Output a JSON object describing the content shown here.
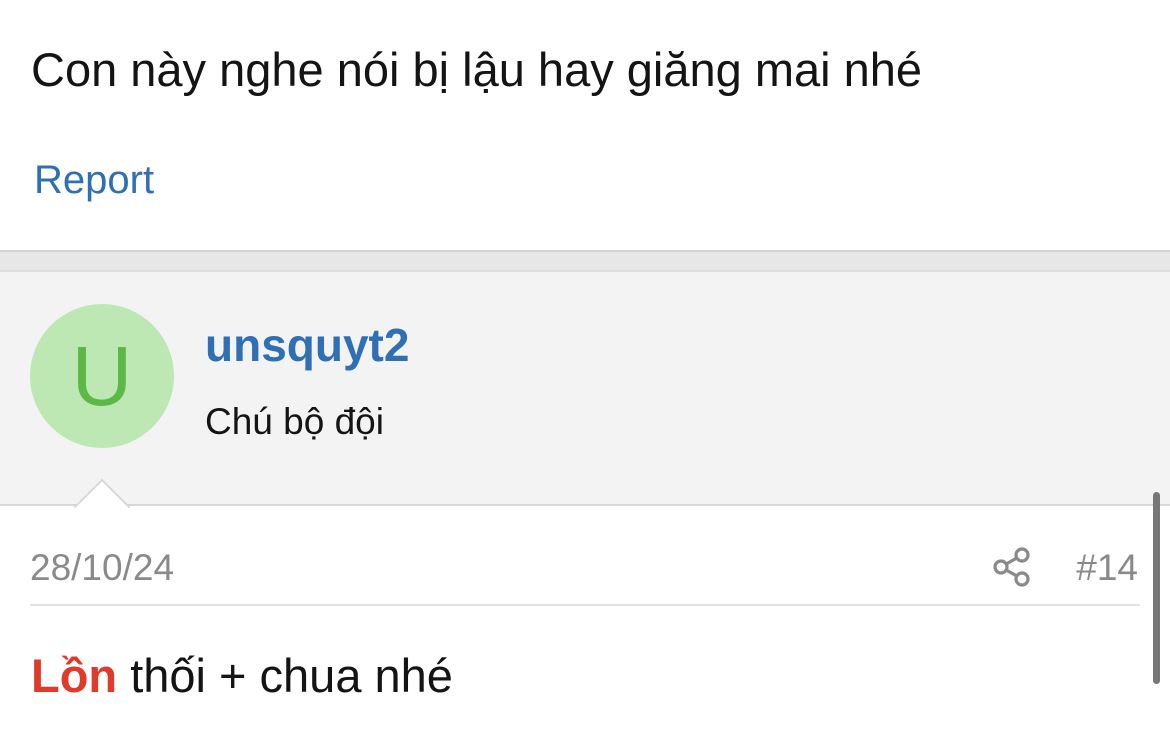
{
  "previous_post": {
    "text": "Con này nghe nói bị lậu hay giăng mai nhé",
    "report_label": "Report"
  },
  "user": {
    "avatar_letter": "U",
    "avatar_bg": "#bde8b3",
    "avatar_fg": "#5db848",
    "username": "unsquyt2",
    "title": "Chú bộ đội"
  },
  "post": {
    "date": "28/10/24",
    "number": "#14",
    "share_icon": "share-icon",
    "highlight_word": "Lồn",
    "highlight_color": "#e03a2a",
    "body_rest": " thối + chua nhé"
  },
  "colors": {
    "link": "#2f6fb4",
    "meta": "#8a8a8a",
    "header_bg": "#f3f3f3"
  }
}
